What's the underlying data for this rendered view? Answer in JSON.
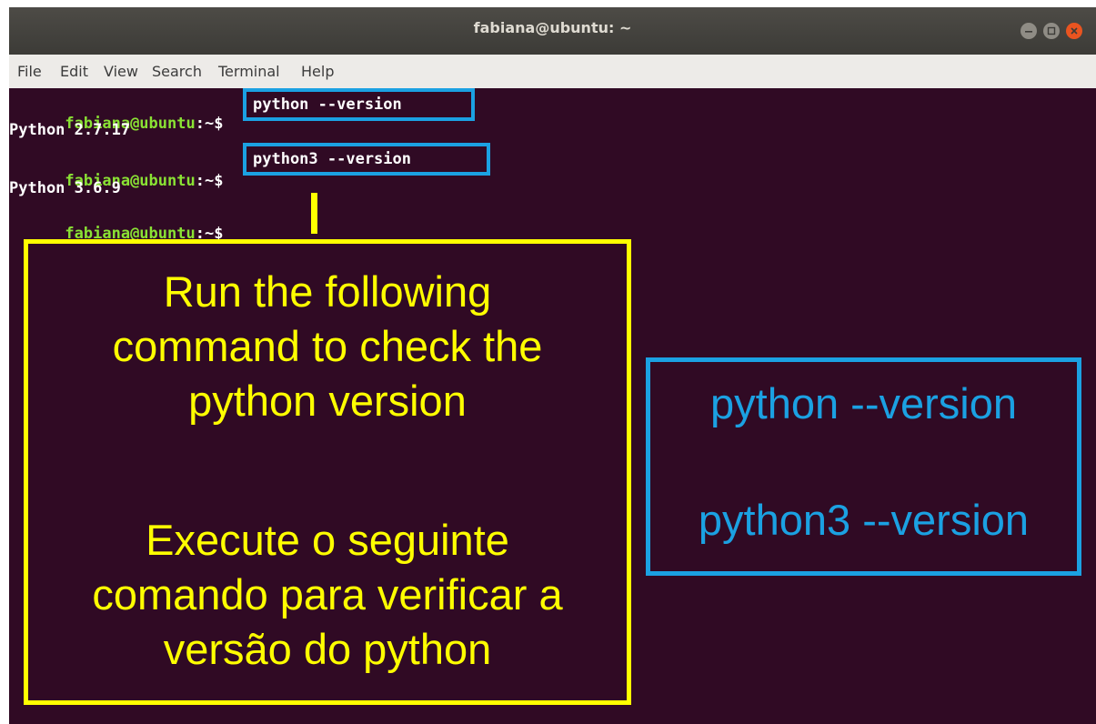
{
  "window": {
    "title": "fabiana@ubuntu: ~",
    "controls": {
      "minimize": "minimize-icon",
      "maximize": "maximize-icon",
      "close": "close-icon"
    }
  },
  "menu": [
    "File",
    "Edit",
    "View",
    "Search",
    "Terminal",
    "Help"
  ],
  "terminal": {
    "prompt_user": "fabiana@ubuntu",
    "prompt_sep": ":~$",
    "lines": [
      {
        "command": "python --version"
      },
      {
        "output": "Python 2.7.17"
      },
      {
        "command": "python3 --version"
      },
      {
        "output": "Python 3.6.9"
      },
      {
        "command": ""
      }
    ]
  },
  "annotation_en": [
    "Run the following",
    "command to check the",
    "python version"
  ],
  "annotation_pt": [
    "Execute o seguinte",
    "comando para verificar a",
    "versão do python"
  ],
  "annotation_commands": [
    "python --version",
    "python3 --version"
  ],
  "colors": {
    "terminal_bg": "#300a24",
    "prompt_green": "#8ae234",
    "highlight_blue": "#1ba1e2",
    "annotation_yellow": "#ffff00",
    "close_orange": "#e95420"
  }
}
